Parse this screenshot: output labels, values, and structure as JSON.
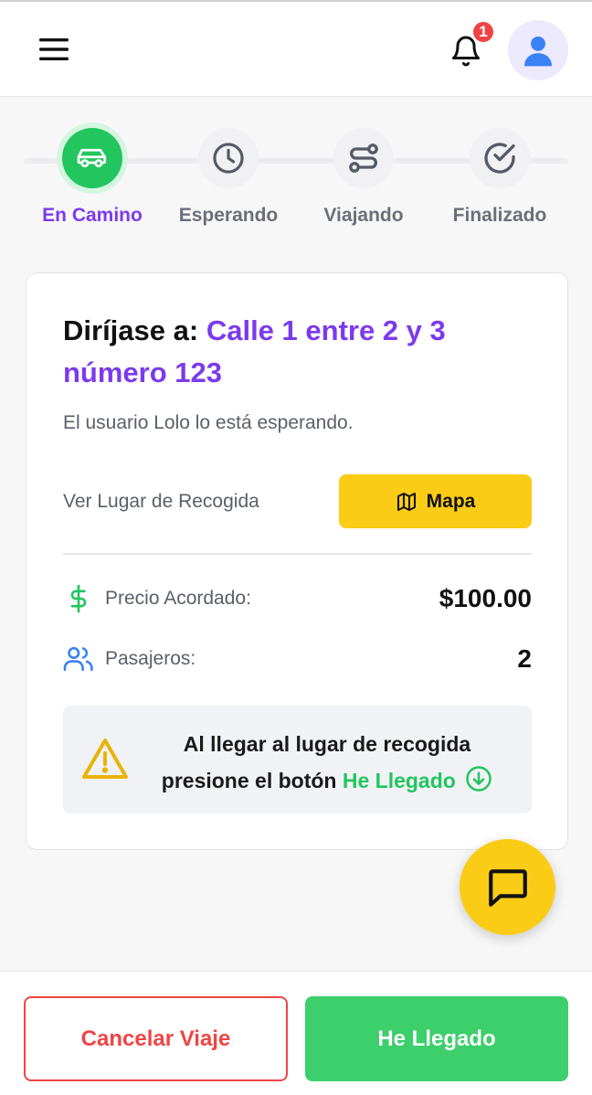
{
  "header": {
    "menu_icon": "hamburger-menu-icon",
    "bell_icon": "bell-icon",
    "notification_count": "1",
    "avatar_icon": "user-icon"
  },
  "stepper": {
    "steps": [
      {
        "label": "En Camino",
        "icon": "car-icon",
        "active": true
      },
      {
        "label": "Esperando",
        "icon": "clock-icon",
        "active": false
      },
      {
        "label": "Viajando",
        "icon": "route-icon",
        "active": false
      },
      {
        "label": "Finalizado",
        "icon": "check-circle-icon",
        "active": false
      }
    ]
  },
  "trip": {
    "heading_prefix": "Diríjase a:",
    "address": "Calle 1 entre 2 y 3 número 123",
    "waiting_text": "El usuario Lolo lo está esperando.",
    "pickup_label": "Ver Lugar de Recogida",
    "map_button": "Mapa",
    "price_label": "Precio Acordado:",
    "price_value": "$100.00",
    "passengers_label": "Pasajeros:",
    "passengers_value": "2",
    "notice_line1": "Al llegar al lugar de recogida",
    "notice_line2_prefix": "presione el botón",
    "notice_highlight": "He Llegado"
  },
  "footer": {
    "cancel_label": "Cancelar Viaje",
    "arrive_label": "He Llegado"
  },
  "colors": {
    "accent_purple": "#7c3aed",
    "success_green": "#22c55e",
    "warning_yellow": "#facc15",
    "danger_red": "#ef4444"
  }
}
